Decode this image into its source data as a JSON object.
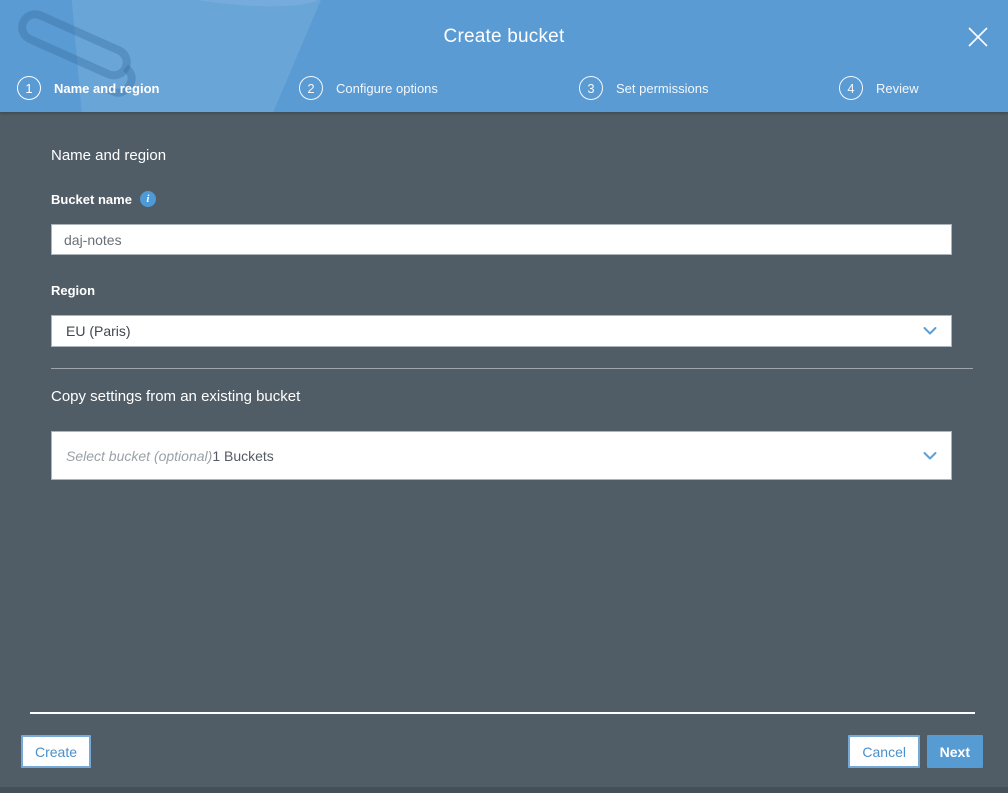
{
  "header": {
    "title": "Create bucket",
    "steps": [
      {
        "number": "1",
        "label": "Name and region",
        "active": true
      },
      {
        "number": "2",
        "label": "Configure options",
        "active": false
      },
      {
        "number": "3",
        "label": "Set permissions",
        "active": false
      },
      {
        "number": "4",
        "label": "Review",
        "active": false
      }
    ]
  },
  "form": {
    "section_heading": "Name and region",
    "bucket_name": {
      "label": "Bucket name",
      "value": "daj-notes",
      "info_icon": "info-icon"
    },
    "region": {
      "label": "Region",
      "value": "EU (Paris)"
    },
    "copy_settings": {
      "heading": "Copy settings from an existing bucket",
      "placeholder": "Select bucket (optional)",
      "buckets_count": "1 Buckets"
    }
  },
  "footer": {
    "create": "Create",
    "cancel": "Cancel",
    "next": "Next"
  },
  "icons": {
    "close": "x-icon",
    "chevron": "chevron-down-icon",
    "watermark": "bucket-watermark-icon",
    "info": "info-icon"
  },
  "colors": {
    "header_blue": "#5a9bd4",
    "body_slate": "#515d66",
    "accent_blue": "#4a90cb",
    "next_button_blue": "#569bd2"
  }
}
